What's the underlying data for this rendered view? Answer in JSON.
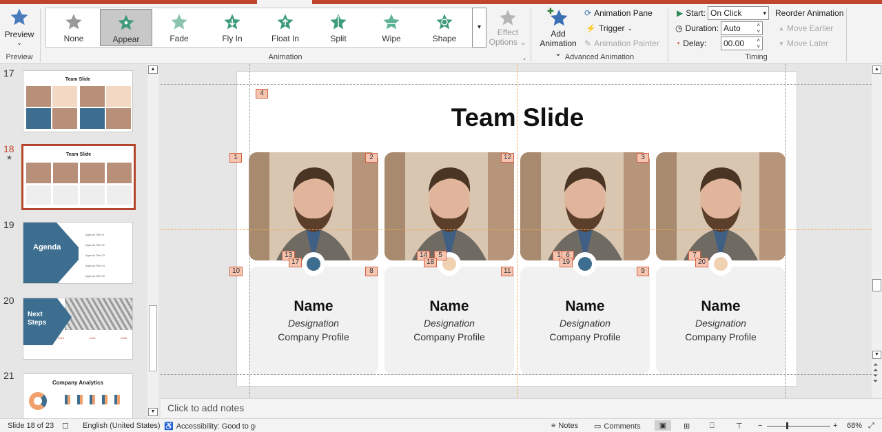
{
  "colors": {
    "accent": "#c0462b",
    "tag_fill": "#f5c5b2",
    "tag_border": "#d2603e",
    "blue_dot": "#3d6e8f",
    "peach_dot": "#f0d2b2",
    "card_bg": "#f1f1f1"
  },
  "ribbon": {
    "preview": {
      "label": "Preview",
      "group": "Preview"
    },
    "animations": [
      {
        "label": "None",
        "icon": "star-none-icon",
        "selected": false
      },
      {
        "label": "Appear",
        "icon": "star-appear-icon",
        "selected": true
      },
      {
        "label": "Fade",
        "icon": "star-fade-icon",
        "selected": false
      },
      {
        "label": "Fly In",
        "icon": "star-flyin-icon",
        "selected": false
      },
      {
        "label": "Float In",
        "icon": "star-floatin-icon",
        "selected": false
      },
      {
        "label": "Split",
        "icon": "star-split-icon",
        "selected": false
      },
      {
        "label": "Wipe",
        "icon": "star-wipe-icon",
        "selected": false
      },
      {
        "label": "Shape",
        "icon": "star-shape-icon",
        "selected": false
      }
    ],
    "effect_options": {
      "line1": "Effect",
      "line2": "Options"
    },
    "animation_group": "Animation",
    "add_animation": {
      "line1": "Add",
      "line2": "Animation"
    },
    "animation_pane": "Animation Pane",
    "trigger": "Trigger",
    "animation_painter": "Animation Painter",
    "advanced_group": "Advanced Animation",
    "timing": {
      "start_label": "Start:",
      "start_value": "On Click",
      "duration_label": "Duration:",
      "duration_value": "Auto",
      "delay_label": "Delay:",
      "delay_value": "00.00",
      "group": "Timing"
    },
    "reorder": {
      "title": "Reorder Animation",
      "earlier": "Move Earlier",
      "later": "Move Later"
    }
  },
  "thumbnails": {
    "slides": [
      {
        "num": "17",
        "title": "Team Slide"
      },
      {
        "num": "18",
        "title": "Team Slide",
        "selected": true,
        "star": "★"
      },
      {
        "num": "19",
        "title": "Agenda",
        "items": [
          "Agenda Title 01",
          "Agenda Title 02",
          "Agenda Title 03",
          "Agenda Title 04",
          "Agenda Title 05"
        ]
      },
      {
        "num": "20",
        "title": "Next Steps",
        "years": [
          "2015",
          "2016",
          "2018"
        ]
      },
      {
        "num": "21",
        "title": "Company Analytics"
      }
    ]
  },
  "slide": {
    "title": "Team Slide",
    "members": [
      {
        "name": "Name",
        "designation": "Designation",
        "company": "Company Profile",
        "dot": "blue"
      },
      {
        "name": "Name",
        "designation": "Designation",
        "company": "Company Profile",
        "dot": "peach"
      },
      {
        "name": "Name",
        "designation": "Designation",
        "company": "Company Profile",
        "dot": "blue"
      },
      {
        "name": "Name",
        "designation": "Designation",
        "company": "Company Profile",
        "dot": "peach"
      }
    ],
    "tags": [
      "4",
      "1",
      "2",
      "12",
      "3",
      "13",
      "17",
      "14",
      "5",
      "18",
      "1",
      "6",
      "19",
      "7",
      "20",
      "10",
      "8",
      "11",
      "9"
    ]
  },
  "notes": {
    "placeholder": "Click to add notes"
  },
  "status": {
    "slide": "Slide 18 of 23",
    "language": "English (United States)",
    "accessibility": "Accessibility: Good to go",
    "notes": "Notes",
    "comments": "Comments",
    "zoom": "68%"
  }
}
